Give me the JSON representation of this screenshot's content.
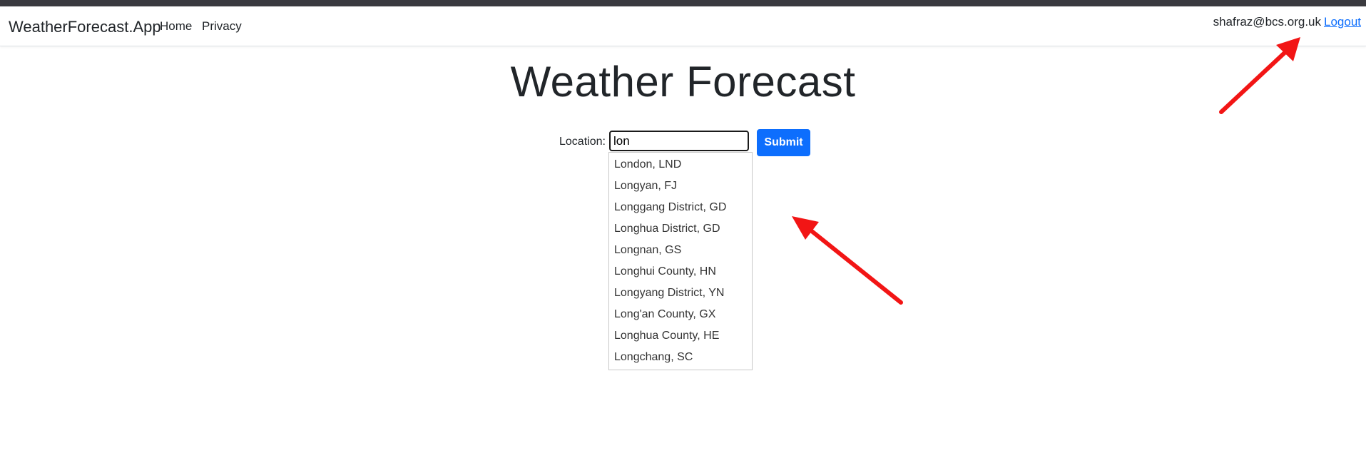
{
  "navbar": {
    "brand": "WeatherForecast.App",
    "links": [
      "Home",
      "Privacy"
    ],
    "user_email": "shafraz@bcs.org.uk",
    "logout_label": "Logout"
  },
  "main": {
    "title": "Weather Forecast",
    "location_label": "Location:",
    "location_value": "lon",
    "submit_label": "Submit",
    "suggestions": [
      "London, LND",
      "Longyan, FJ",
      "Longgang District, GD",
      "Longhua District, GD",
      "Longnan, GS",
      "Longhui County, HN",
      "Longyang District, YN",
      "Long'an County, GX",
      "Longhua County, HE",
      "Longchang, SC"
    ]
  },
  "annotations": {
    "arrow_color": "#f21515"
  },
  "colors": {
    "accent": "#0d6efd",
    "top_strip": "#3a3a3f"
  }
}
